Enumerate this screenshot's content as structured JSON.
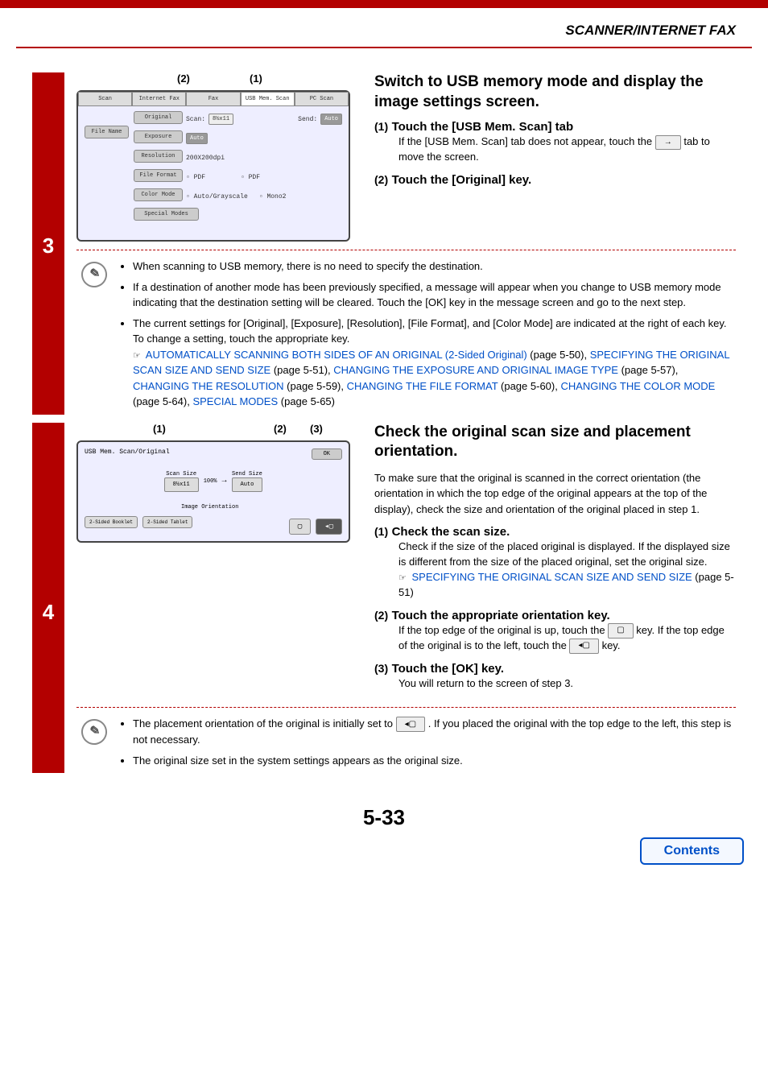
{
  "header": {
    "section_title": "SCANNER/INTERNET FAX"
  },
  "step3": {
    "number": "3",
    "callout1": "(1)",
    "callout2": "(2)",
    "panel": {
      "tabs": {
        "scan": "Scan",
        "ifax": "Internet Fax",
        "fax": "Fax",
        "usb": "USB Mem. Scan",
        "pc": "PC Scan"
      },
      "file_name_btn": "File Name",
      "original_btn": "Original",
      "scan_label": "Scan:",
      "scan_val": "8½x11",
      "send_label": "Send:",
      "send_val": "Auto",
      "exposure_btn": "Exposure",
      "exposure_val": "Auto",
      "resolution_btn": "Resolution",
      "resolution_val": "200X200dpi",
      "fileformat_btn": "File Format",
      "ff_val1": "PDF",
      "ff_val2": "PDF",
      "colormode_btn": "Color Mode",
      "cm_val1": "Auto/Grayscale",
      "cm_val2": "Mono2",
      "special_btn": "Special Modes"
    },
    "title": "Switch to USB memory mode and display the image settings screen.",
    "sub1_num": "(1)",
    "sub1_title": "Touch the [USB Mem. Scan] tab",
    "sub1_text_a": "If the [USB Mem. Scan] tab does not appear, touch the ",
    "sub1_text_b": " tab to move the screen.",
    "arrow_icon": "→",
    "sub2_num": "(2)",
    "sub2_title": "Touch the [Original] key.",
    "notes": {
      "n1": "When scanning to USB memory, there is no need to specify the destination.",
      "n2": "If a destination of another mode has been previously specified, a message will appear when you change to USB memory mode indicating that the destination setting will be cleared. Touch the [OK] key in the message screen and go to the next step.",
      "n3": "The current settings for [Original], [Exposure], [Resolution], [File Format], and [Color Mode] are indicated at the right of each key. To change a setting, touch the appropriate key.",
      "ref_icon": "☞",
      "link1": "AUTOMATICALLY SCANNING BOTH SIDES OF AN ORIGINAL (2-Sided Original)",
      "link1_page": " (page 5-50), ",
      "link2": "SPECIFYING THE ORIGINAL SCAN SIZE AND SEND SIZE",
      "link2_page": " (page 5-51), ",
      "link3": "CHANGING THE EXPOSURE AND ORIGINAL IMAGE TYPE",
      "link3_page": " (page 5-57), ",
      "link4": "CHANGING THE RESOLUTION",
      "link4_page": " (page 5-59), ",
      "link5": "CHANGING THE FILE FORMAT",
      "link5_page": " (page 5-60), ",
      "link6": "CHANGING THE COLOR MODE",
      "link6_page": " (page 5-64), ",
      "link7": "SPECIAL MODES",
      "link7_page": " (page 5-65)"
    }
  },
  "step4": {
    "number": "4",
    "callout1": "(1)",
    "callout2": "(2)",
    "callout3": "(3)",
    "panel": {
      "title": "USB Mem. Scan/Original",
      "ok": "OK",
      "scan_size_label": "Scan Size",
      "scan_size_val": "8½x11",
      "pct": "100%",
      "send_size_label": "Send Size",
      "send_size_val": "Auto",
      "orient_label": "Image Orientation",
      "ts_booklet": "2-Sided\nBooklet",
      "ts_tablet": "2-Sided\nTablet"
    },
    "title": "Check the original scan size and placement orientation.",
    "intro": "To make sure that the original is scanned in the correct orientation (the orientation in which the top edge of the original appears at the top of the display), check the size and orientation of the original placed in step 1.",
    "sub1_num": "(1)",
    "sub1_title": "Check the scan size.",
    "sub1_text": "Check if the size of the placed original is displayed. If the displayed size is different from the size of the placed original, set the original size.",
    "ref_icon": "☞",
    "sub1_link": "SPECIFYING THE ORIGINAL SCAN SIZE AND SEND SIZE",
    "sub1_link_page": " (page 5-51)",
    "sub2_num": "(2)",
    "sub2_title": "Touch the appropriate orientation key.",
    "sub2_text_a": "If the top edge of the original is up, touch the ",
    "sub2_text_b": " key. If the top edge of the original is to the left, touch the ",
    "sub2_text_c": " key.",
    "sub3_num": "(3)",
    "sub3_title": "Touch the [OK] key.",
    "sub3_text": "You will return to the screen of step 3.",
    "notes": {
      "n1a": "The placement orientation of the original is initially set to ",
      "n1b": " . If you placed the original with the top edge to the left, this step is not necessary.",
      "n2": "The original size set in the system settings appears as the original size."
    }
  },
  "footer": {
    "page_num": "5-33",
    "contents": "Contents"
  }
}
